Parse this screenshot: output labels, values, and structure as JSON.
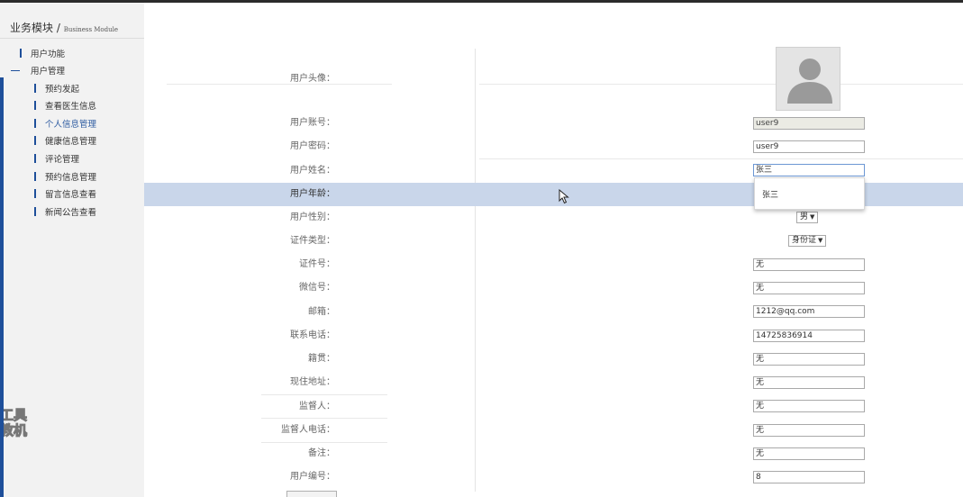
{
  "sidebar": {
    "title": "业务模块",
    "separator": "/",
    "title_en": "Business Module",
    "items": [
      {
        "label": "用户功能"
      },
      {
        "label": "用户管理"
      },
      {
        "label": "预约发起"
      },
      {
        "label": "查看医生信息"
      },
      {
        "label": "个人信息管理"
      },
      {
        "label": "健康信息管理"
      },
      {
        "label": "评论管理"
      },
      {
        "label": "预约信息管理"
      },
      {
        "label": "留言信息查看"
      },
      {
        "label": "新闻公告查看"
      }
    ]
  },
  "watermark": [
    "工具",
    "教机"
  ],
  "form": {
    "avatar_label": "用户头像：",
    "fields": [
      {
        "label": "用户账号：",
        "value": "user9"
      },
      {
        "label": "用户密码：",
        "value": "user9"
      },
      {
        "label": "用户姓名：",
        "value": "张三"
      },
      {
        "label": "用户年龄：",
        "value": ""
      },
      {
        "label": "用户性别：",
        "value": "男"
      },
      {
        "label": "证件类型：",
        "value": "身份证"
      },
      {
        "label": "证件号：",
        "value": "无"
      },
      {
        "label": "微信号：",
        "value": "无"
      },
      {
        "label": "邮箱：",
        "value": "1212@qq.com"
      },
      {
        "label": "联系电话：",
        "value": "14725836914"
      },
      {
        "label": "籍贯：",
        "value": "无"
      },
      {
        "label": "现住地址：",
        "value": "无"
      },
      {
        "label": "监督人：",
        "value": "无"
      },
      {
        "label": "监督人电话：",
        "value": "无"
      },
      {
        "label": "备注：",
        "value": "无"
      },
      {
        "label": "用户编号：",
        "value": "8"
      }
    ]
  },
  "autocomplete": {
    "option": "张三"
  },
  "colors": {
    "accent": "#1e4f9a",
    "highlight_row": "#c9d6ea",
    "sidebar_bg": "#f2f2f2"
  },
  "icons": {
    "avatar": "person-silhouette-icon",
    "cursor": "mouse-pointer-icon"
  }
}
